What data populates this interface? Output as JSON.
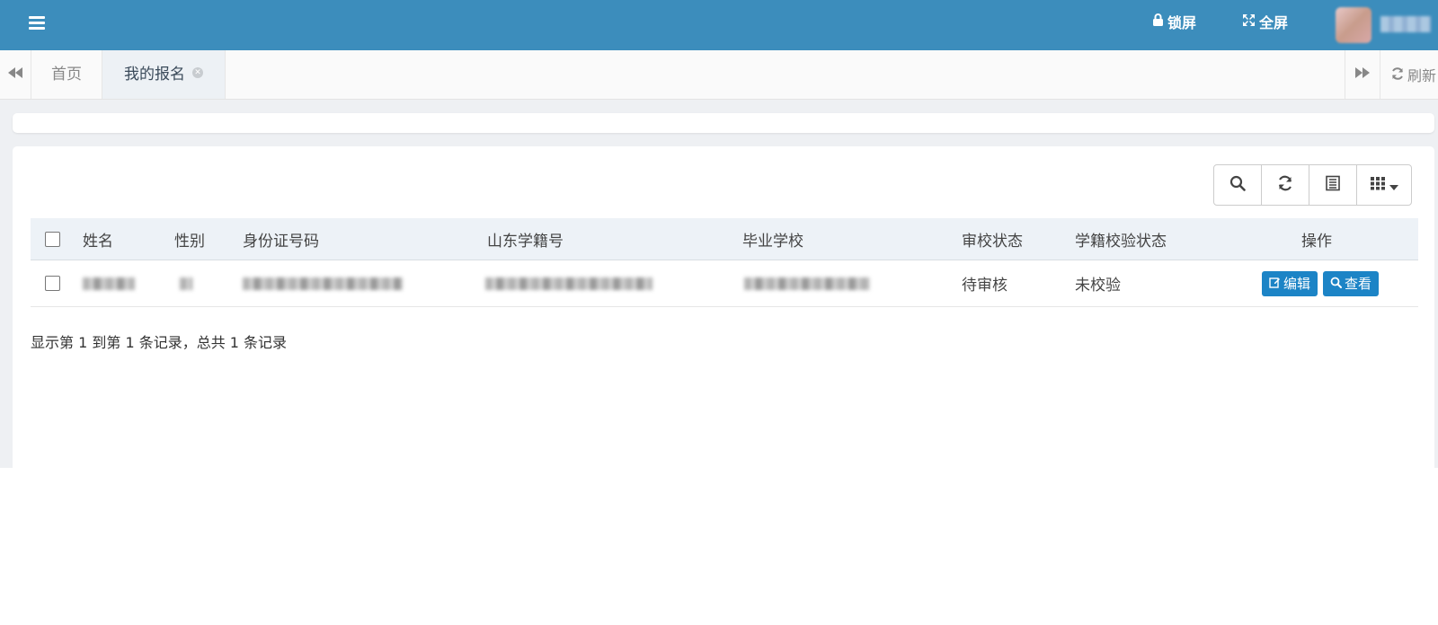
{
  "header": {
    "lock_label": "锁屏",
    "fullscreen_label": "全屏",
    "bg_color": "#3c8dbc"
  },
  "tabs": {
    "home_label": "首页",
    "active_label": "我的报名",
    "refresh_label": "刷新"
  },
  "table": {
    "columns": [
      "姓名",
      "性别",
      "身份证号码",
      "山东学籍号",
      "毕业学校",
      "审校状态",
      "学籍校验状态",
      "操作"
    ],
    "rows": [
      {
        "audit_status": "待审核",
        "verify_status": "未校验",
        "edit_label": "编辑",
        "view_label": "查看"
      }
    ]
  },
  "summary": "显示第 1 到第 1 条记录，总共 1 条记录"
}
